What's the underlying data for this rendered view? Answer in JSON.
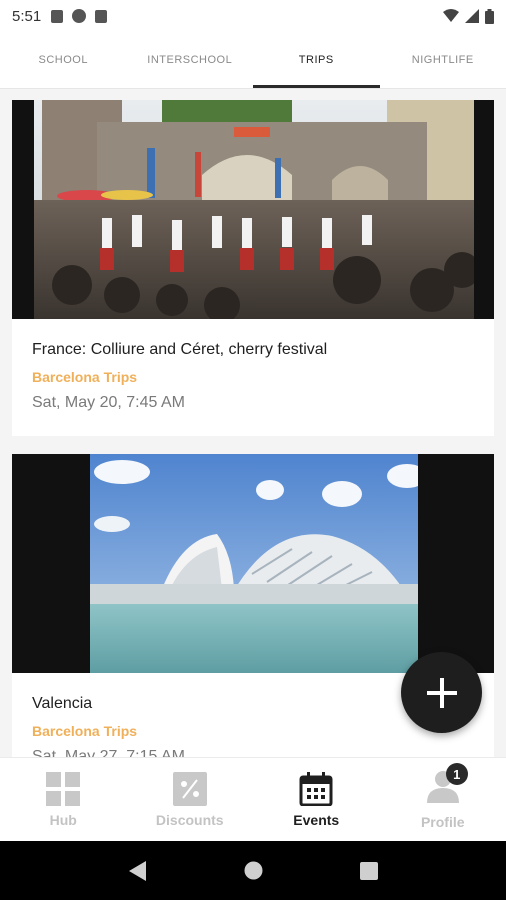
{
  "status_bar": {
    "time": "5:51"
  },
  "tabs": [
    {
      "label": "SCHOOL",
      "active": false
    },
    {
      "label": "INTERSCHOOL",
      "active": false
    },
    {
      "label": "TRIPS",
      "active": true
    },
    {
      "label": "NIGHTLIFE",
      "active": false
    }
  ],
  "events": [
    {
      "title": "France: Colliure and Céret, cherry festival",
      "category": "Barcelona Trips",
      "date": "Sat, May 20, 7:45 AM",
      "image": "festival-photo"
    },
    {
      "title": "Valencia",
      "category": "Barcelona Trips",
      "date": "Sat, May 27, 7:15 AM",
      "image": "valencia-photo"
    }
  ],
  "fab": {
    "icon": "plus-icon"
  },
  "bottom_nav": [
    {
      "label": "Hub",
      "icon": "grid-icon",
      "active": false
    },
    {
      "label": "Discounts",
      "icon": "discount-icon",
      "active": false
    },
    {
      "label": "Events",
      "icon": "calendar-icon",
      "active": true
    },
    {
      "label": "Profile",
      "icon": "profile-icon",
      "active": false,
      "badge": "1"
    }
  ],
  "colors": {
    "accent": "#f0b05a",
    "fab": "#1e1e1e",
    "inactive": "#c3c3c3"
  }
}
